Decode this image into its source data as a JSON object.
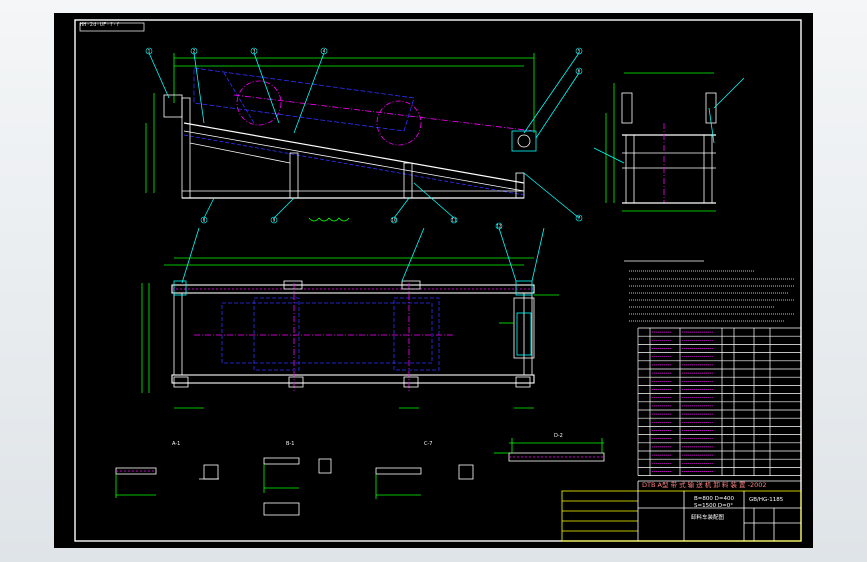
{
  "drawing": {
    "corner_tag": "HH·2d·UF·f·f",
    "colors": {
      "border": "#ffffff",
      "structure": "#ffffff",
      "dimension": "#00ff00",
      "hidden": "#3030ff",
      "centerline": "#ff00ff",
      "leader": "#00ffff",
      "title_block": "#ffff00",
      "red": "#ff3030"
    },
    "part_bubbles": [
      "1",
      "2",
      "3",
      "4",
      "5",
      "6",
      "7",
      "8",
      "9",
      "10",
      "11",
      "12"
    ],
    "view_labels": [
      "A-1",
      "B-1",
      "C-7",
      "D-2"
    ],
    "title_block": {
      "title": "DTB A型  带 式 输 送 机 卸 料 装 置 -2002",
      "specs": [
        "B=800  D=400",
        "S=1500  D=0°",
        "GB/HG-1185"
      ],
      "drawing_name": "卸料车装配图"
    }
  }
}
